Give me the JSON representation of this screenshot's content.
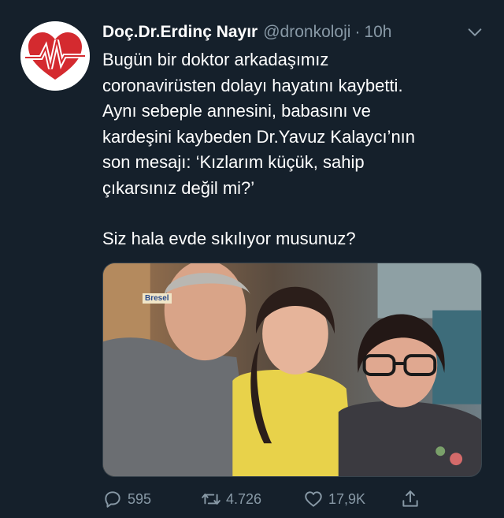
{
  "tweet": {
    "display_name": "Doç.Dr.Erdinç Nayır",
    "handle": "@dronkoloji",
    "separator": "·",
    "time": "10h",
    "lines": [
      "Bugün bir doktor arkadaşımız",
      "coronavirüsten dolayı hayatını kaybetti.",
      "Aynı sebeple annesini, babasını ve",
      "kardeşini kaybeden Dr.Yavuz Kalaycı’nın",
      "son mesajı: ‘Kızlarım küçük, sahip",
      "çıkarsınız değil mi?’"
    ],
    "closing_line": "Siz hala evde sıkılıyor musunuz?",
    "photo_sign_text": "Bresel"
  },
  "actions": {
    "reply_count": "595",
    "retweet_count": "4.726",
    "like_count": "17,9K"
  },
  "icons": {
    "avatar": "heartbeat-logo-icon",
    "caret": "chevron-down-icon",
    "reply": "reply-icon",
    "retweet": "retweet-icon",
    "like": "heart-icon",
    "share": "share-icon"
  },
  "colors": {
    "background": "#15202b",
    "secondary_text": "#8899a6",
    "avatar_red": "#d42a2f"
  }
}
